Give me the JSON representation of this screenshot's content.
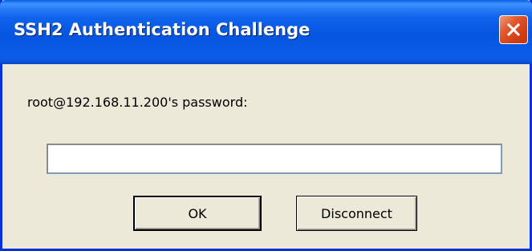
{
  "window": {
    "title": "SSH2 Authentication Challenge",
    "close_icon": "close-x-icon"
  },
  "dialog": {
    "prompt": "root@192.168.11.200's password:",
    "password_value": ""
  },
  "buttons": {
    "ok_label": "OK",
    "disconnect_label": "Disconnect"
  },
  "colors": {
    "titlebar": "#0655e0",
    "face": "#ece9d8",
    "close": "#d23f16"
  }
}
